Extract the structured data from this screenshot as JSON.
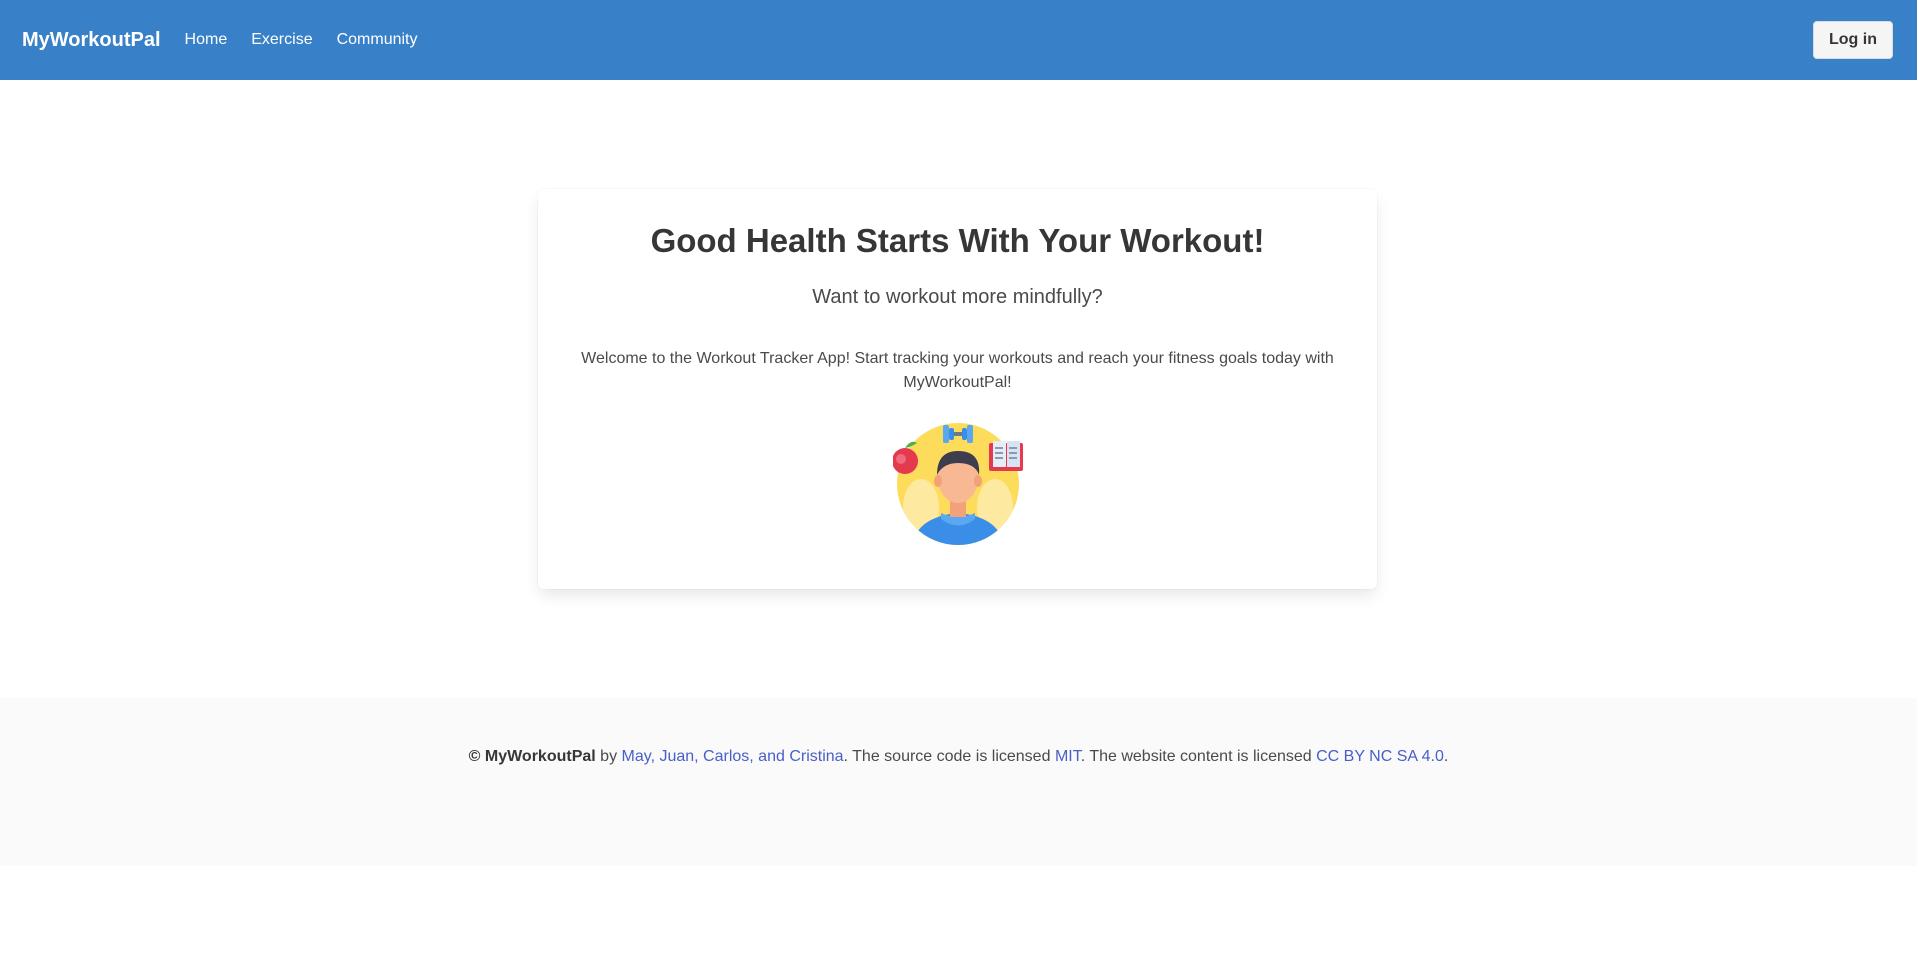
{
  "navbar": {
    "brand": "MyWorkoutPal",
    "links": [
      "Home",
      "Exercise",
      "Community"
    ],
    "login_label": "Log in"
  },
  "hero": {
    "title": "Good Health Starts With Your Workout!",
    "subtitle": "Want to workout more mindfully?",
    "text": "Welcome to the Workout Tracker App! Start tracking your workouts and reach your fitness goals today with MyWorkoutPal!",
    "illustration": "fitness-person-illustration"
  },
  "footer": {
    "copyright_symbol": "©",
    "brand": "MyWorkoutPal",
    "by": "by",
    "authors_link": "May, Juan, Carlos, and Cristina",
    "source_text": ". The source code is licensed",
    "source_license_link": "MIT",
    "content_text": ". The website content is licensed",
    "content_license_link": "CC BY NC SA 4.0",
    "end": "."
  },
  "colors": {
    "navbar": "#3880c8",
    "link": "#485fc7",
    "footer_bg": "#fafafa"
  }
}
